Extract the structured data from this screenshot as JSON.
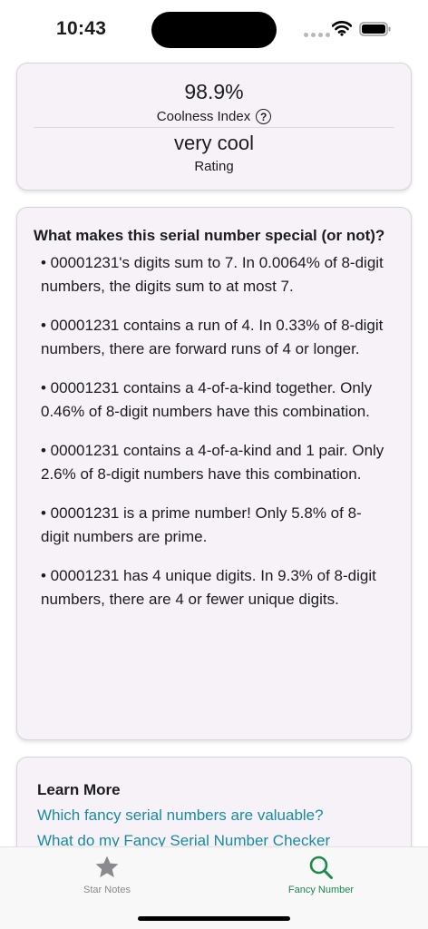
{
  "status_bar": {
    "time": "10:43"
  },
  "score_card": {
    "coolness_value": "98.9%",
    "coolness_label": "Coolness Index",
    "help_symbol": "?",
    "rating_value": "very cool",
    "rating_label": "Rating"
  },
  "facts_card": {
    "heading": "What makes this serial number special (or not)?",
    "items": [
      "• 00001231's digits sum to 7. In 0.0064% of 8-digit numbers, the digits sum to at most 7.",
      "• 00001231 contains a run of 4. In 0.33% of 8-digit numbers, there are forward runs of 4 or longer.",
      "• 00001231 contains a 4-of-a-kind together. Only 0.46% of 8-digit numbers have this combination.",
      "• 00001231 contains a 4-of-a-kind and 1 pair. Only 2.6% of 8-digit numbers have this combination.",
      "• 00001231 is a prime number! Only 5.8% of 8-digit numbers are prime.",
      "• 00001231 has 4 unique digits. In 9.3% of 8-digit numbers, there are 4 or fewer unique digits."
    ]
  },
  "learn_card": {
    "heading": "Learn More",
    "links": [
      "Which fancy serial numbers are valuable?",
      "What do my Fancy Serial Number Checker"
    ]
  },
  "tab_bar": {
    "tabs": [
      {
        "label": "Star Notes",
        "icon": "star-icon",
        "selected": false
      },
      {
        "label": "Fancy Number",
        "icon": "magnifier-icon",
        "selected": true
      }
    ]
  },
  "colors": {
    "link": "#1a8aa1",
    "tab_selected": "#1b8a4a",
    "tab_unselected": "#8a8a8e",
    "card_background": "#f6f2f7"
  }
}
